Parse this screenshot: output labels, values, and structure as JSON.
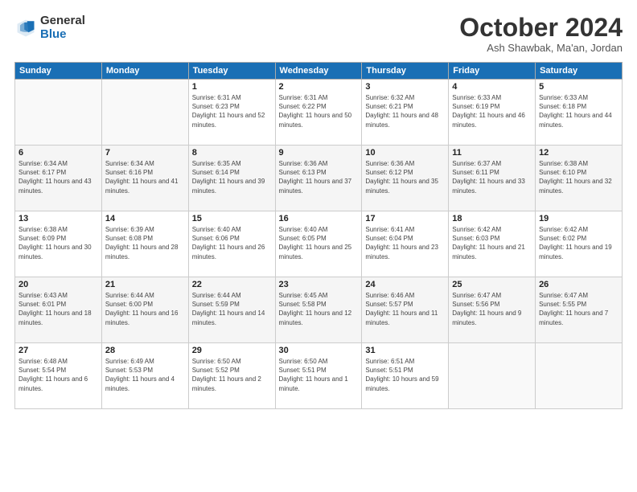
{
  "logo": {
    "general": "General",
    "blue": "Blue"
  },
  "title": "October 2024",
  "location": "Ash Shawbak, Ma'an, Jordan",
  "headers": [
    "Sunday",
    "Monday",
    "Tuesday",
    "Wednesday",
    "Thursday",
    "Friday",
    "Saturday"
  ],
  "weeks": [
    [
      {
        "day": "",
        "sunrise": "",
        "sunset": "",
        "daylight": ""
      },
      {
        "day": "",
        "sunrise": "",
        "sunset": "",
        "daylight": ""
      },
      {
        "day": "1",
        "sunrise": "Sunrise: 6:31 AM",
        "sunset": "Sunset: 6:23 PM",
        "daylight": "Daylight: 11 hours and 52 minutes."
      },
      {
        "day": "2",
        "sunrise": "Sunrise: 6:31 AM",
        "sunset": "Sunset: 6:22 PM",
        "daylight": "Daylight: 11 hours and 50 minutes."
      },
      {
        "day": "3",
        "sunrise": "Sunrise: 6:32 AM",
        "sunset": "Sunset: 6:21 PM",
        "daylight": "Daylight: 11 hours and 48 minutes."
      },
      {
        "day": "4",
        "sunrise": "Sunrise: 6:33 AM",
        "sunset": "Sunset: 6:19 PM",
        "daylight": "Daylight: 11 hours and 46 minutes."
      },
      {
        "day": "5",
        "sunrise": "Sunrise: 6:33 AM",
        "sunset": "Sunset: 6:18 PM",
        "daylight": "Daylight: 11 hours and 44 minutes."
      }
    ],
    [
      {
        "day": "6",
        "sunrise": "Sunrise: 6:34 AM",
        "sunset": "Sunset: 6:17 PM",
        "daylight": "Daylight: 11 hours and 43 minutes."
      },
      {
        "day": "7",
        "sunrise": "Sunrise: 6:34 AM",
        "sunset": "Sunset: 6:16 PM",
        "daylight": "Daylight: 11 hours and 41 minutes."
      },
      {
        "day": "8",
        "sunrise": "Sunrise: 6:35 AM",
        "sunset": "Sunset: 6:14 PM",
        "daylight": "Daylight: 11 hours and 39 minutes."
      },
      {
        "day": "9",
        "sunrise": "Sunrise: 6:36 AM",
        "sunset": "Sunset: 6:13 PM",
        "daylight": "Daylight: 11 hours and 37 minutes."
      },
      {
        "day": "10",
        "sunrise": "Sunrise: 6:36 AM",
        "sunset": "Sunset: 6:12 PM",
        "daylight": "Daylight: 11 hours and 35 minutes."
      },
      {
        "day": "11",
        "sunrise": "Sunrise: 6:37 AM",
        "sunset": "Sunset: 6:11 PM",
        "daylight": "Daylight: 11 hours and 33 minutes."
      },
      {
        "day": "12",
        "sunrise": "Sunrise: 6:38 AM",
        "sunset": "Sunset: 6:10 PM",
        "daylight": "Daylight: 11 hours and 32 minutes."
      }
    ],
    [
      {
        "day": "13",
        "sunrise": "Sunrise: 6:38 AM",
        "sunset": "Sunset: 6:09 PM",
        "daylight": "Daylight: 11 hours and 30 minutes."
      },
      {
        "day": "14",
        "sunrise": "Sunrise: 6:39 AM",
        "sunset": "Sunset: 6:08 PM",
        "daylight": "Daylight: 11 hours and 28 minutes."
      },
      {
        "day": "15",
        "sunrise": "Sunrise: 6:40 AM",
        "sunset": "Sunset: 6:06 PM",
        "daylight": "Daylight: 11 hours and 26 minutes."
      },
      {
        "day": "16",
        "sunrise": "Sunrise: 6:40 AM",
        "sunset": "Sunset: 6:05 PM",
        "daylight": "Daylight: 11 hours and 25 minutes."
      },
      {
        "day": "17",
        "sunrise": "Sunrise: 6:41 AM",
        "sunset": "Sunset: 6:04 PM",
        "daylight": "Daylight: 11 hours and 23 minutes."
      },
      {
        "day": "18",
        "sunrise": "Sunrise: 6:42 AM",
        "sunset": "Sunset: 6:03 PM",
        "daylight": "Daylight: 11 hours and 21 minutes."
      },
      {
        "day": "19",
        "sunrise": "Sunrise: 6:42 AM",
        "sunset": "Sunset: 6:02 PM",
        "daylight": "Daylight: 11 hours and 19 minutes."
      }
    ],
    [
      {
        "day": "20",
        "sunrise": "Sunrise: 6:43 AM",
        "sunset": "Sunset: 6:01 PM",
        "daylight": "Daylight: 11 hours and 18 minutes."
      },
      {
        "day": "21",
        "sunrise": "Sunrise: 6:44 AM",
        "sunset": "Sunset: 6:00 PM",
        "daylight": "Daylight: 11 hours and 16 minutes."
      },
      {
        "day": "22",
        "sunrise": "Sunrise: 6:44 AM",
        "sunset": "Sunset: 5:59 PM",
        "daylight": "Daylight: 11 hours and 14 minutes."
      },
      {
        "day": "23",
        "sunrise": "Sunrise: 6:45 AM",
        "sunset": "Sunset: 5:58 PM",
        "daylight": "Daylight: 11 hours and 12 minutes."
      },
      {
        "day": "24",
        "sunrise": "Sunrise: 6:46 AM",
        "sunset": "Sunset: 5:57 PM",
        "daylight": "Daylight: 11 hours and 11 minutes."
      },
      {
        "day": "25",
        "sunrise": "Sunrise: 6:47 AM",
        "sunset": "Sunset: 5:56 PM",
        "daylight": "Daylight: 11 hours and 9 minutes."
      },
      {
        "day": "26",
        "sunrise": "Sunrise: 6:47 AM",
        "sunset": "Sunset: 5:55 PM",
        "daylight": "Daylight: 11 hours and 7 minutes."
      }
    ],
    [
      {
        "day": "27",
        "sunrise": "Sunrise: 6:48 AM",
        "sunset": "Sunset: 5:54 PM",
        "daylight": "Daylight: 11 hours and 6 minutes."
      },
      {
        "day": "28",
        "sunrise": "Sunrise: 6:49 AM",
        "sunset": "Sunset: 5:53 PM",
        "daylight": "Daylight: 11 hours and 4 minutes."
      },
      {
        "day": "29",
        "sunrise": "Sunrise: 6:50 AM",
        "sunset": "Sunset: 5:52 PM",
        "daylight": "Daylight: 11 hours and 2 minutes."
      },
      {
        "day": "30",
        "sunrise": "Sunrise: 6:50 AM",
        "sunset": "Sunset: 5:51 PM",
        "daylight": "Daylight: 11 hours and 1 minute."
      },
      {
        "day": "31",
        "sunrise": "Sunrise: 6:51 AM",
        "sunset": "Sunset: 5:51 PM",
        "daylight": "Daylight: 10 hours and 59 minutes."
      },
      {
        "day": "",
        "sunrise": "",
        "sunset": "",
        "daylight": ""
      },
      {
        "day": "",
        "sunrise": "",
        "sunset": "",
        "daylight": ""
      }
    ]
  ]
}
